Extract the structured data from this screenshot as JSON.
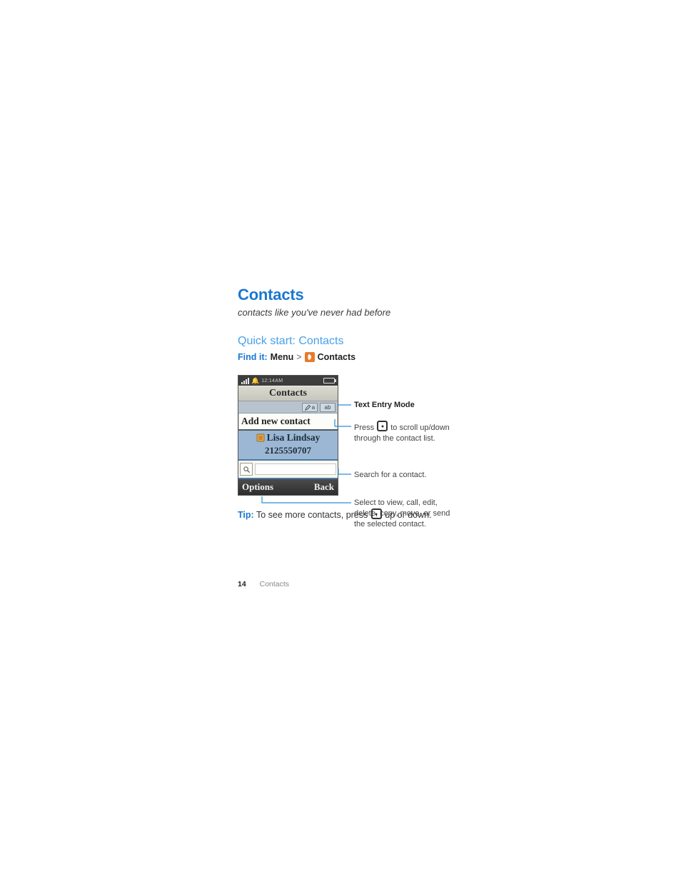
{
  "page": {
    "heading": "Contacts",
    "subtitle": "contacts like you've never had before",
    "quickstart_heading": "Quick start: Contacts",
    "findit_label": "Find it:",
    "findit_path1": "Menu",
    "findit_separator": ">",
    "findit_path2": "Contacts"
  },
  "phone": {
    "status_time": "12:14AM",
    "title": "Contacts",
    "mode_text1": "a",
    "mode_text2": "ab",
    "add_label": "Add new contact",
    "contact_name": "Lisa Lindsay",
    "contact_number": "2125550707",
    "softkey_left": "Options",
    "softkey_right": "Back"
  },
  "callouts": {
    "c1": "Text Entry Mode",
    "c2a": "Press",
    "c2b": "to scroll up/down through the contact list.",
    "c3": "Search for a contact.",
    "c4": "Select to view, call, edit, delete, copy, move, or send the selected contact."
  },
  "tip": {
    "label": "Tip:",
    "text_a": "To see more contacts, press",
    "text_b": "up or down."
  },
  "footer": {
    "page_number": "14",
    "section": "Contacts"
  }
}
